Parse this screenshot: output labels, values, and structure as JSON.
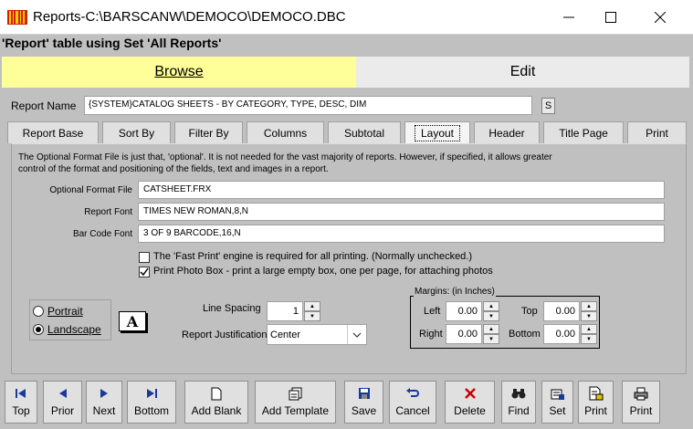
{
  "window": {
    "title": "Reports-C:\\BARSCANW\\DEMOCO\\DEMOCO.DBC"
  },
  "subtitle": "'Report' table using Set 'All Reports'",
  "mode_tabs": {
    "browse": "Browse",
    "edit": "Edit"
  },
  "report_name": {
    "label": "Report Name",
    "value": "{SYSTEM}CATALOG SHEETS - BY CATEGORY, TYPE, DESC, DIM",
    "s_button": "S"
  },
  "tabs": [
    "Report Base",
    "Sort By",
    "Filter By",
    "Columns",
    "Subtotal",
    "Layout",
    "Header",
    "Title Page",
    "Print"
  ],
  "active_tab": "Layout",
  "layout": {
    "description": "The Optional Format File is just that, 'optional'. It is not needed for the vast majority of reports. However, if specified, it allows greater control of the format and positioning of the fields, text and images in a report.",
    "format_file_label": "Optional Format File",
    "format_file_value": "CATSHEET.FRX",
    "report_font_label": "Report Font",
    "report_font_value": "TIMES NEW ROMAN,8,N",
    "barcode_font_label": "Bar Code Font",
    "barcode_font_value": "3 OF 9 BARCODE,16,N",
    "fast_print_label": "The 'Fast Print'  engine is required for all printing. (Normally unchecked.)",
    "fast_print_checked": false,
    "photo_box_label": "Print Photo Box - print a large empty box, one per page, for attaching photos",
    "photo_box_checked": true,
    "portrait_label": "Portrait",
    "landscape_label": "Landscape",
    "orientation": "Landscape",
    "line_spacing_label": "Line Spacing",
    "line_spacing_value": "1",
    "justification_label": "Report Justification",
    "justification_value": "Center",
    "margins_title": "Margins: (in Inches)",
    "margin_left_label": "Left",
    "margin_left_value": "0.00",
    "margin_top_label": "Top",
    "margin_top_value": "0.00",
    "margin_right_label": "Right",
    "margin_right_value": "0.00",
    "margin_bottom_label": "Bottom",
    "margin_bottom_value": "0.00"
  },
  "toolbar": {
    "top": "Top",
    "prior": "Prior",
    "next": "Next",
    "bottom": "Bottom",
    "add_blank": "Add Blank",
    "add_template": "Add Template",
    "save": "Save",
    "cancel": "Cancel",
    "delete": "Delete",
    "find": "Find",
    "set": "Set",
    "print_report": "Print",
    "print": "Print"
  },
  "colors": {
    "browse_tab": "#ffff99",
    "background": "#c0c0c0",
    "nav_icon": "#1a3a9a",
    "delete_icon": "#cc0000"
  }
}
